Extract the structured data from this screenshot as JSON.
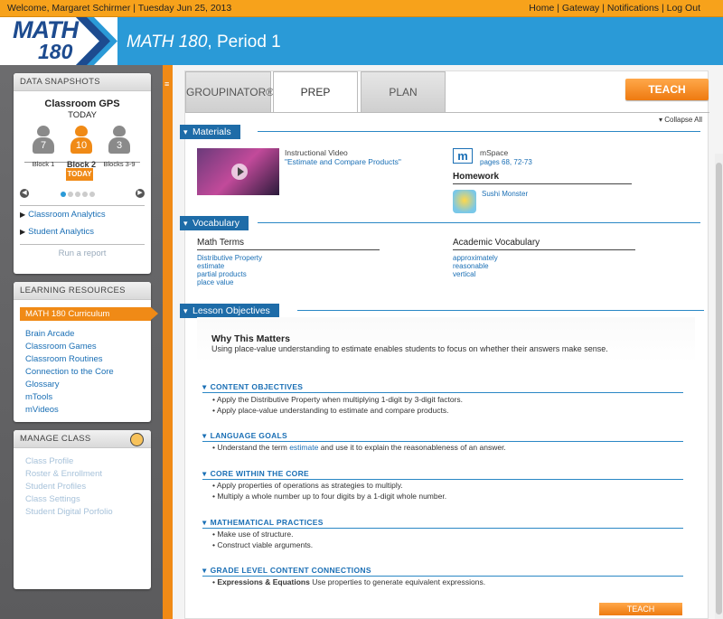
{
  "topbar": {
    "welcome": "Welcome, Margaret Schirmer   |   Tuesday Jun 25, 2013",
    "nav": [
      "Home",
      "Gateway",
      "Notifications",
      "Log Out"
    ]
  },
  "header": {
    "logo_top": "MATH",
    "logo_bottom": "180",
    "class_name": "MATH 180",
    "class_period": ", Period 1"
  },
  "sidebar": {
    "snapshots": {
      "title": "DATA SNAPSHOTS",
      "gps_title": "Classroom GPS",
      "gps_sub": "TODAY",
      "blocks": [
        {
          "count": "7",
          "label": "Block 1"
        },
        {
          "count": "10",
          "label": "Block 2"
        },
        {
          "count": "3",
          "label": "Blocks 3-9"
        }
      ],
      "today_btn": "TODAY",
      "links": [
        "Classroom Analytics",
        "Student Analytics"
      ],
      "run_report": "Run a report"
    },
    "learning": {
      "title": "LEARNING RESOURCES",
      "active": "MATH 180 Curriculum",
      "items": [
        "Brain Arcade",
        "Classroom Games",
        "Classroom Routines",
        "Connection to the Core",
        "Glossary",
        "mTools",
        "mVideos"
      ]
    },
    "manage": {
      "title": "MANAGE CLASS",
      "items": [
        "Class Profile",
        "Roster & Enrollment",
        "Student Profiles",
        "Class Settings",
        "Student Digital Porfolio"
      ]
    }
  },
  "tabs": [
    "GROUPINATOR®",
    "PREP",
    "PLAN"
  ],
  "teach_label": "TEACH",
  "collapse_all": "Collapse All",
  "materials": {
    "title": "Materials",
    "video_type": "Instructional Video",
    "video_title": "\"Estimate and Compare Products\"",
    "mspace": "mSpace",
    "mspace_pages": "pages 68, 72-73",
    "homework": "Homework",
    "homework_item": "Sushi Monster"
  },
  "vocabulary": {
    "title": "Vocabulary",
    "math_terms_title": "Math Terms",
    "math_terms": [
      "Distributive Property",
      "estimate",
      "partial products",
      "place value"
    ],
    "academic_title": "Academic Vocabulary",
    "academic": [
      "approximately",
      "reasonable",
      "vertical"
    ]
  },
  "objectives": {
    "title": "Lesson Objectives",
    "why_title": "Why This Matters",
    "why_text": "Using place-value understanding to estimate enables students to focus on whether their answers make sense.",
    "groups": [
      {
        "heading": "CONTENT OBJECTIVES",
        "bullets": [
          "Apply the Distributive Property when multiplying 1-digit by 3-digit factors.",
          "Apply place-value understanding to estimate and compare products."
        ]
      },
      {
        "heading": "LANGUAGE GOALS",
        "bullets": [
          "Understand the term",
          "estimate",
          "and use it to explain the reasonableness of an answer."
        ]
      },
      {
        "heading": "CORE WITHIN THE CORE",
        "bullets": [
          "Apply properties of operations as strategies to multiply.",
          "Multiply a whole number up to four digits by a 1-digit whole number."
        ]
      },
      {
        "heading": "MATHEMATICAL PRACTICES",
        "bullets": [
          "Make use of structure.",
          "Construct viable arguments."
        ]
      },
      {
        "heading": "GRADE LEVEL CONTENT CONNECTIONS",
        "bullets": [
          "Expressions & Equations",
          "Use properties to generate equivalent expressions."
        ]
      }
    ]
  }
}
